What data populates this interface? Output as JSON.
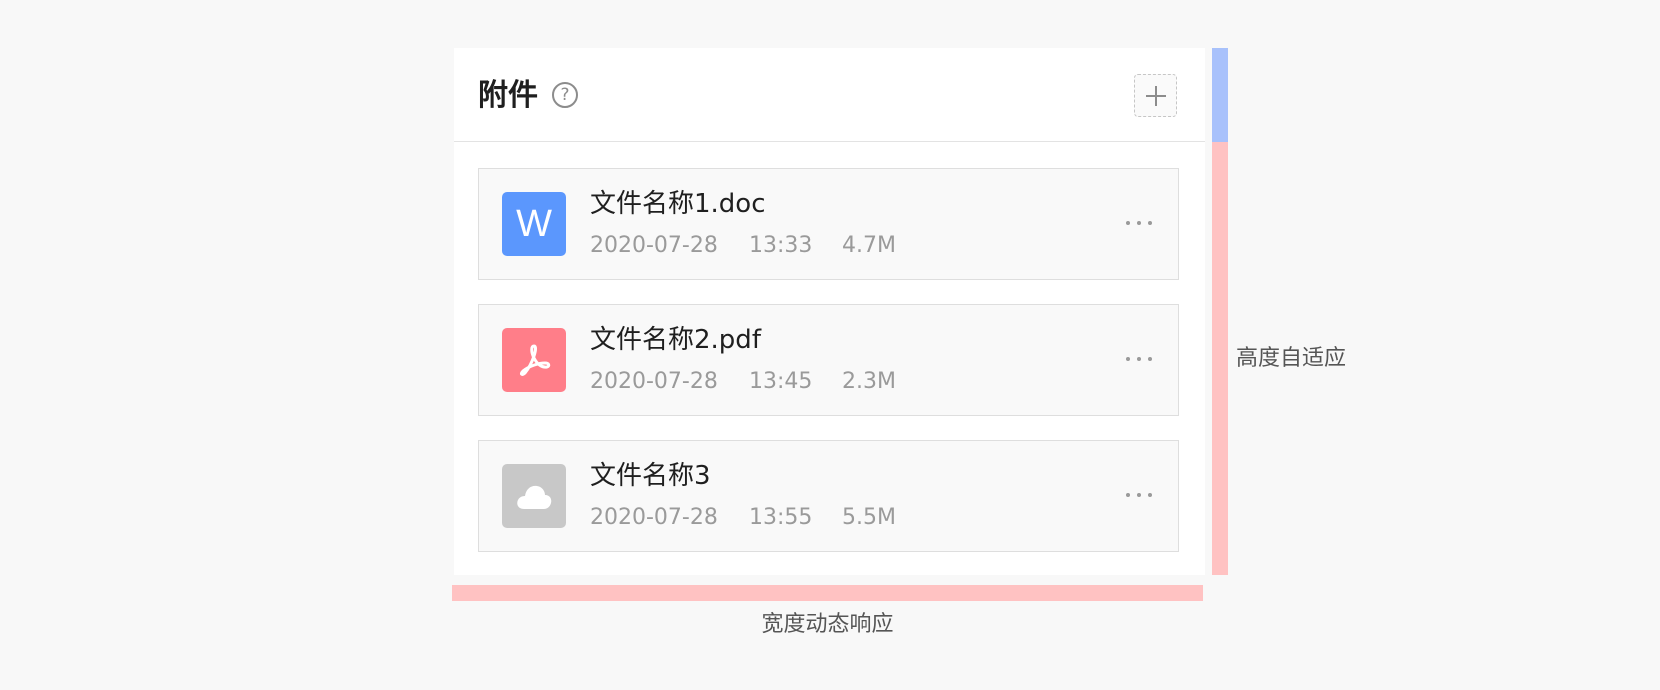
{
  "header": {
    "title": "附件",
    "help_glyph": "?",
    "add_icon": "plus-icon"
  },
  "files": [
    {
      "name": "文件名称1.doc",
      "date": "2020-07-28",
      "time": "13:33",
      "size": "4.7M",
      "icon": "word-doc-icon",
      "icon_letter": "W",
      "icon_color": "#5b97fd"
    },
    {
      "name": "文件名称2.pdf",
      "date": "2020-07-28",
      "time": "13:45",
      "size": "2.3M",
      "icon": "pdf-icon",
      "icon_color": "#ff7e89"
    },
    {
      "name": "文件名称3",
      "date": "2020-07-28",
      "time": "13:55",
      "size": "5.5M",
      "icon": "cloud-icon",
      "icon_color": "#c8c8c8"
    }
  ],
  "annotations": {
    "height_label": "高度自适应",
    "width_label": "宽度动态响应",
    "header_bar_color": "#a8c1fb",
    "body_bar_color": "#ffc2c2"
  }
}
